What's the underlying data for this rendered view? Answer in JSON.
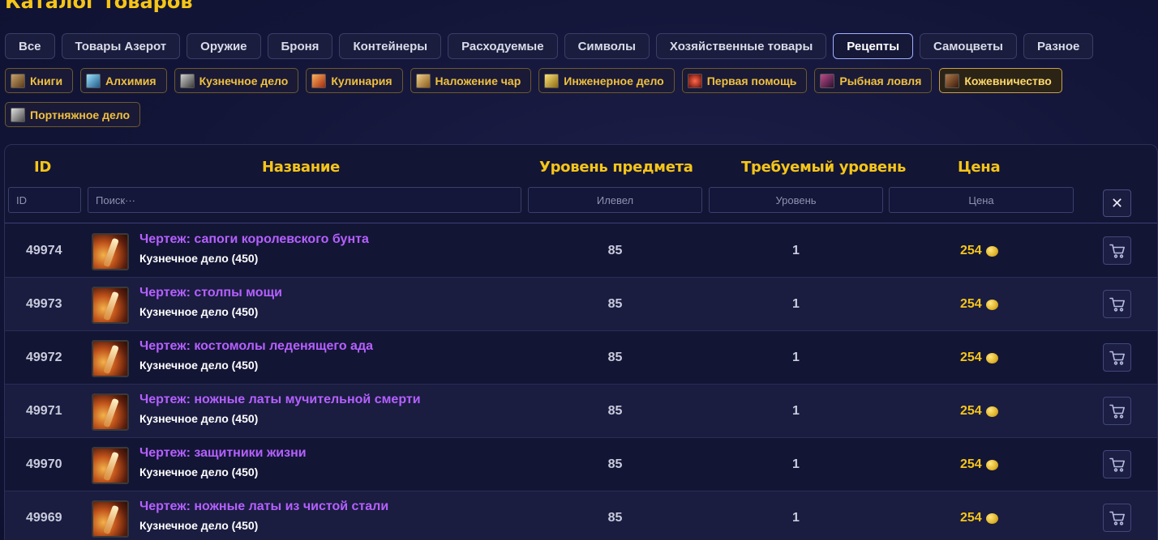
{
  "page_title": "Каталог товаров",
  "categories": [
    {
      "label": "Все",
      "active": false
    },
    {
      "label": "Товары Азерот",
      "active": false
    },
    {
      "label": "Оружие",
      "active": false
    },
    {
      "label": "Броня",
      "active": false
    },
    {
      "label": "Контейнеры",
      "active": false
    },
    {
      "label": "Расходуемые",
      "active": false
    },
    {
      "label": "Символы",
      "active": false
    },
    {
      "label": "Хозяйственные товары",
      "active": false
    },
    {
      "label": "Рецепты",
      "active": true
    },
    {
      "label": "Самоцветы",
      "active": false
    },
    {
      "label": "Разное",
      "active": false
    }
  ],
  "subcategories": [
    {
      "label": "Книги",
      "icon": "book-icon",
      "color": "#8a6b3a"
    },
    {
      "label": "Алхимия",
      "icon": "potion-icon",
      "color": "#4aa3c8"
    },
    {
      "label": "Кузнечное дело",
      "icon": "anvil-icon",
      "color": "#8a8a8a"
    },
    {
      "label": "Кулинария",
      "icon": "cooking-icon",
      "color": "#d8502a"
    },
    {
      "label": "Наложение чар",
      "icon": "enchant-scroll-icon",
      "color": "#c89a3a"
    },
    {
      "label": "Инженерное дело",
      "icon": "engineering-icon",
      "color": "#d8b040"
    },
    {
      "label": "Первая помощь",
      "icon": "first-aid-icon",
      "color": "#b02a2a"
    },
    {
      "label": "Рыбная ловля",
      "icon": "fishing-icon",
      "color": "#7a3a5a"
    },
    {
      "label": "Кожевничество",
      "icon": "leather-icon",
      "color": "#7a4a2a",
      "active": true
    },
    {
      "label": "Портняжное дело",
      "icon": "tailoring-icon",
      "color": "#9a9a9a"
    }
  ],
  "table": {
    "headers": {
      "id": "ID",
      "name": "Название",
      "ilvl": "Уровень предмета",
      "req": "Требуемый уровень",
      "price": "Цена"
    },
    "filters": {
      "id_placeholder": "ID",
      "search_placeholder": "Поиск···",
      "ilvl_placeholder": "Илевел",
      "req_placeholder": "Уровень",
      "price_placeholder": "Цена"
    },
    "clear_label": "✕",
    "rows": [
      {
        "id": "49974",
        "name": "Чертеж: сапоги королевского бунта",
        "sub": "Кузнечное дело (450)",
        "ilvl": "85",
        "req": "1",
        "price": "254"
      },
      {
        "id": "49973",
        "name": "Чертеж: столпы мощи",
        "sub": "Кузнечное дело (450)",
        "ilvl": "85",
        "req": "1",
        "price": "254"
      },
      {
        "id": "49972",
        "name": "Чертеж: костомолы леденящего ада",
        "sub": "Кузнечное дело (450)",
        "ilvl": "85",
        "req": "1",
        "price": "254"
      },
      {
        "id": "49971",
        "name": "Чертеж: ножные латы мучительной смерти",
        "sub": "Кузнечное дело (450)",
        "ilvl": "85",
        "req": "1",
        "price": "254"
      },
      {
        "id": "49970",
        "name": "Чертеж: защитники жизни",
        "sub": "Кузнечное дело (450)",
        "ilvl": "85",
        "req": "1",
        "price": "254"
      },
      {
        "id": "49969",
        "name": "Чертеж: ножные латы из чистой стали",
        "sub": "Кузнечное дело (450)",
        "ilvl": "85",
        "req": "1",
        "price": "254"
      }
    ]
  },
  "colors": {
    "accent_gold": "#f5c518",
    "item_purple": "#b560ff",
    "background": "#14163a"
  }
}
